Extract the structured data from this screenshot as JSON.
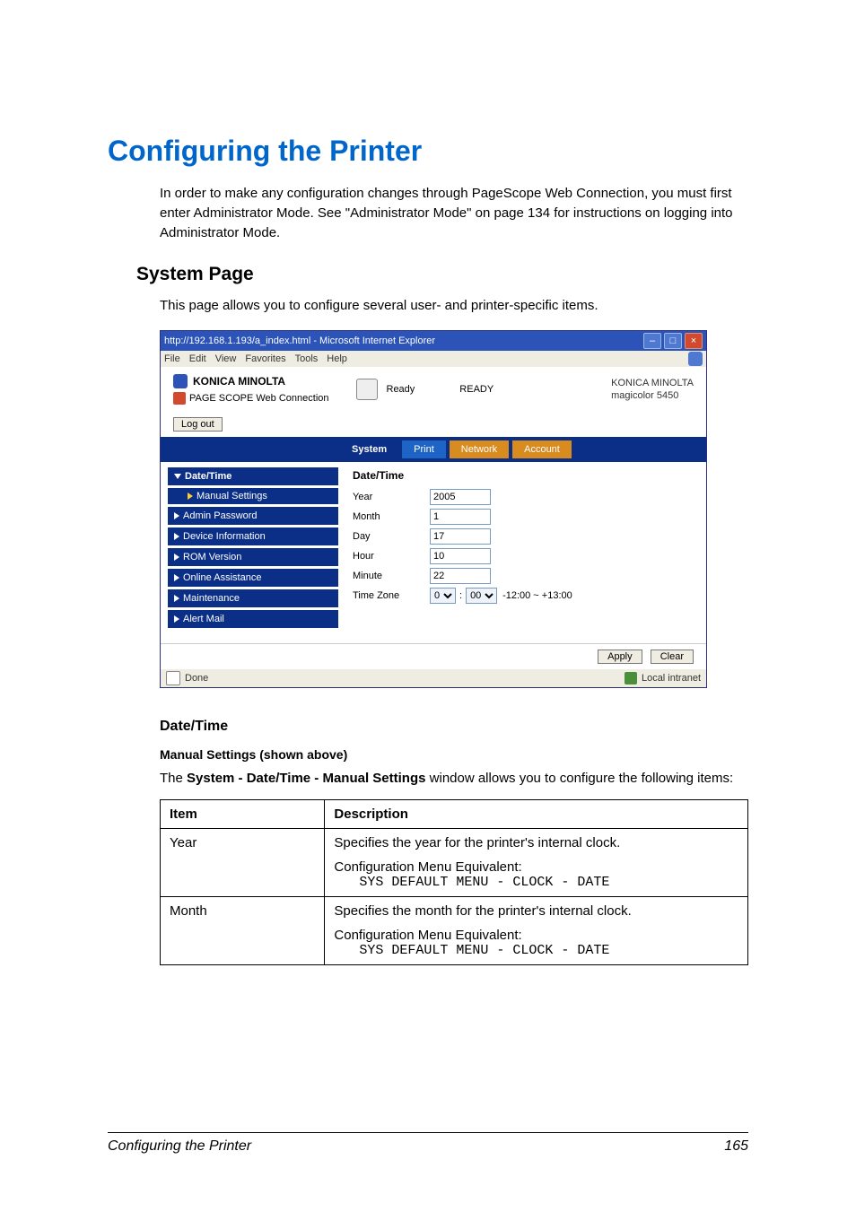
{
  "page_title": "Configuring the Printer",
  "intro_text": "In order to make any configuration changes through PageScope Web Connection, you must first enter Administrator Mode. See \"Administrator Mode\" on page 134 for instructions on logging into Administrator Mode.",
  "system_page_heading": "System Page",
  "system_page_text": "This page allows you to configure several user- and printer-specific items.",
  "screenshot": {
    "window_title": "http://192.168.1.193/a_index.html - Microsoft Internet Explorer",
    "menu": {
      "file": "File",
      "edit": "Edit",
      "view": "View",
      "favorites": "Favorites",
      "tools": "Tools",
      "help": "Help"
    },
    "logo_text": "KONICA MINOLTA",
    "sub_logo_text": "PAGE SCOPE Web Connection",
    "printer_status_label": "Ready",
    "printer_status_big": "READY",
    "device_brand": "KONICA MINOLTA",
    "device_model": "magicolor 5450",
    "logout_label": "Log out",
    "tabs": {
      "system": "System",
      "print": "Print",
      "network": "Network",
      "account": "Account"
    },
    "sidebar": {
      "date_time": "Date/Time",
      "manual_settings": "Manual Settings",
      "admin_password": "Admin Password",
      "device_information": "Device Information",
      "rom_version": "ROM Version",
      "online_assistance": "Online Assistance",
      "maintenance": "Maintenance",
      "alert_mail": "Alert Mail"
    },
    "form": {
      "heading": "Date/Time",
      "year_label": "Year",
      "year_value": "2005",
      "month_label": "Month",
      "month_value": "1",
      "day_label": "Day",
      "day_value": "17",
      "hour_label": "Hour",
      "hour_value": "10",
      "minute_label": "Minute",
      "minute_value": "22",
      "timezone_label": "Time Zone",
      "tz_hour": "0",
      "tz_min": "00",
      "tz_range": " -12:00 ~ +13:00"
    },
    "apply_label": "Apply",
    "clear_label": "Clear",
    "status_done": "Done",
    "status_zone": "Local intranet"
  },
  "date_time_heading": "Date/Time",
  "manual_settings_heading": "Manual Settings (shown above)",
  "manual_settings_para_prefix": "The ",
  "manual_settings_para_bold": "System - Date/Time - Manual Settings",
  "manual_settings_para_suffix": " window allows you to configure the following items:",
  "table": {
    "h_item": "Item",
    "h_desc": "Description",
    "rows": [
      {
        "item": "Year",
        "desc_line": "Specifies the year for the printer's internal clock.",
        "cfg_label": "Configuration Menu Equivalent:",
        "cfg_mono": "SYS DEFAULT MENU - CLOCK - DATE"
      },
      {
        "item": "Month",
        "desc_line": "Specifies the month for the printer's internal clock.",
        "cfg_label": "Configuration Menu Equivalent:",
        "cfg_mono": "SYS DEFAULT MENU - CLOCK - DATE"
      }
    ]
  },
  "footer_title": "Configuring the Printer",
  "footer_page": "165"
}
